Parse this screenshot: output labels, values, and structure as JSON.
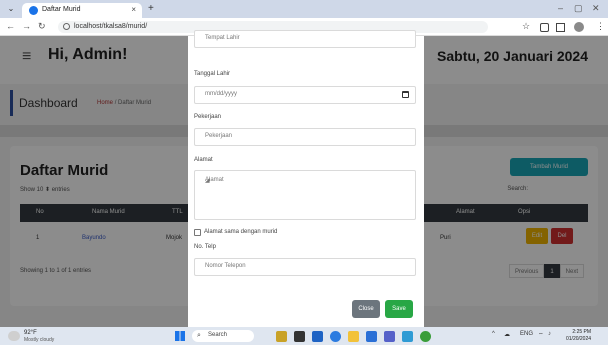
{
  "browser": {
    "tab_title": "Daftar Murid",
    "tab_close": "×",
    "new_tab": "+",
    "url": "localhost/tkalsa8/murid/",
    "back": "←",
    "forward": "→",
    "reload": "↻",
    "minimize": "–",
    "maximize": "▢",
    "close": "✕",
    "star": "☆",
    "menu": "⋮"
  },
  "header": {
    "greeting": "Hi, Admin!",
    "date": "Sabtu, 20 Januari 2024",
    "hamburger": "≡"
  },
  "dashboard": {
    "title": "Dashboard",
    "crumb_home": "Home",
    "crumb_current": "/ Daftar Murid"
  },
  "card": {
    "title": "Daftar Murid",
    "add_button": "Tambah Murid",
    "show_label": "Show   10   ⬍   entries",
    "search_label": "Search:",
    "columns": {
      "no": "No",
      "name": "Nama Murid",
      "ttl": "TTL",
      "alamat": "Alamat",
      "opsi": "Opsi"
    },
    "row": {
      "no": "1",
      "name": "Bayundo",
      "ttl": "Mojok",
      "alamat": "Puri",
      "edit": "Edit",
      "del": "Del"
    },
    "showing": "Showing 1 to 1 of 1 entries",
    "pager": {
      "prev": "Previous",
      "page": "1",
      "next": "Next"
    }
  },
  "modal": {
    "tempat_lahir_placeholder": "Tempat Lahir",
    "tanggal_lahir_label": "Tanggal Lahir",
    "tanggal_lahir_placeholder": "mm/dd/yyyy",
    "pekerjaan_label": "Pekerjaan",
    "pekerjaan_placeholder": "Pekerjaan",
    "alamat_label": "Alamat",
    "alamat_placeholder": "Alamat",
    "checkbox_label": "Alamat sama dengan murid",
    "telp_label": "No. Telp",
    "telp_placeholder": "Nomor Telepon",
    "close_button": "Close",
    "save_button": "Save"
  },
  "taskbar": {
    "temp": "92°F",
    "condition": "Mostly cloudy",
    "search": "Search",
    "lang": "ENG",
    "time": "2:25 PM",
    "date": "01/20/2024"
  }
}
